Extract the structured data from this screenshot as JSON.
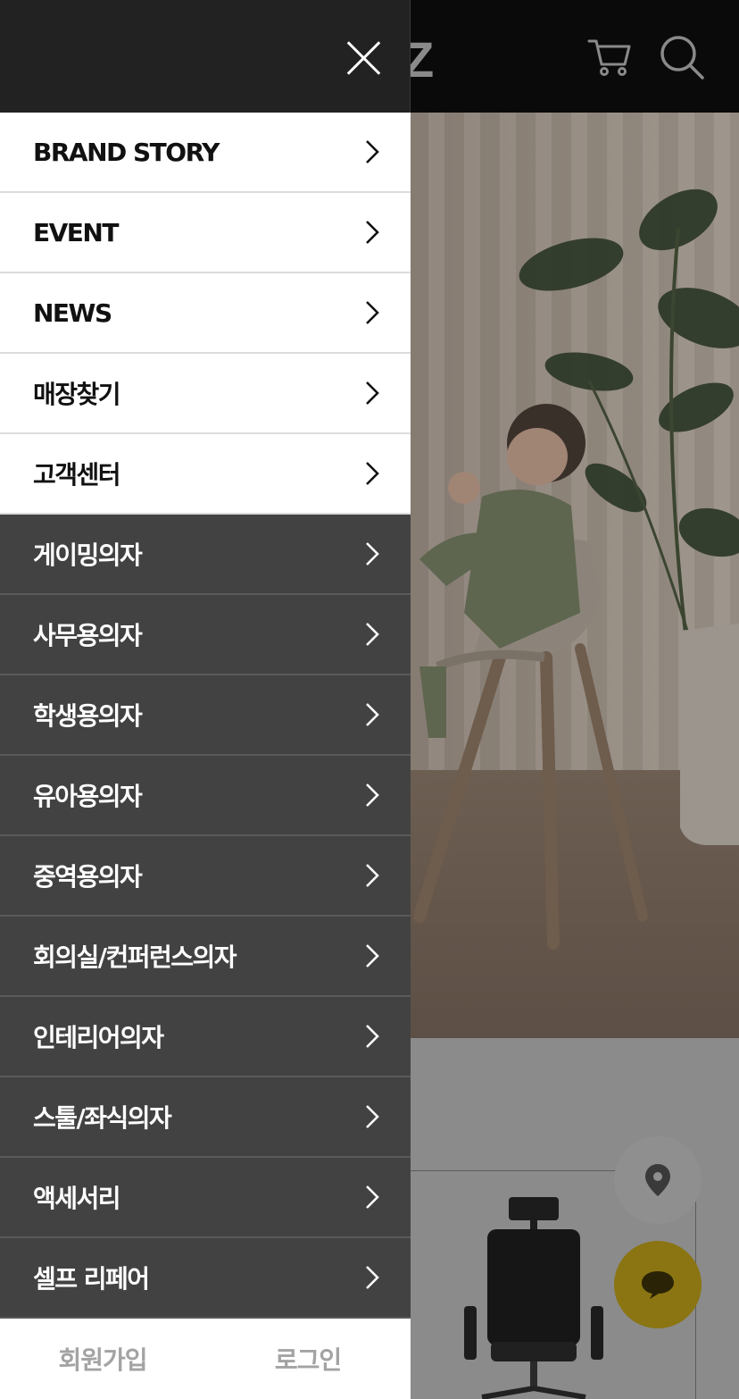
{
  "background": {
    "logo_fragment": "Z",
    "header_icons": [
      "cart-icon",
      "search-icon"
    ],
    "fabs": [
      "map-pin-icon",
      "chat-bubble-icon"
    ]
  },
  "drawer": {
    "close_icon": "close-icon",
    "menu": [
      {
        "label": "BRAND STORY",
        "theme": "light"
      },
      {
        "label": "EVENT",
        "theme": "light"
      },
      {
        "label": "NEWS",
        "theme": "light"
      },
      {
        "label": "매장찾기",
        "theme": "light"
      },
      {
        "label": "고객센터",
        "theme": "light"
      },
      {
        "label": "게이밍의자",
        "theme": "dark"
      },
      {
        "label": "사무용의자",
        "theme": "dark"
      },
      {
        "label": "학생용의자",
        "theme": "dark"
      },
      {
        "label": "유아용의자",
        "theme": "dark"
      },
      {
        "label": "중역용의자",
        "theme": "dark"
      },
      {
        "label": "회의실/컨퍼런스의자",
        "theme": "dark"
      },
      {
        "label": "인테리어의자",
        "theme": "dark"
      },
      {
        "label": "스툴/좌식의자",
        "theme": "dark"
      },
      {
        "label": "액세서리",
        "theme": "dark"
      },
      {
        "label": "셀프 리페어",
        "theme": "dark"
      }
    ],
    "footer": {
      "signup_label": "회원가입",
      "login_label": "로그인"
    }
  },
  "colors": {
    "drawer_header_bg": "#222222",
    "dark_item_bg": "#424242",
    "light_item_bg": "#ffffff",
    "chat_fab": "#8a7512"
  }
}
